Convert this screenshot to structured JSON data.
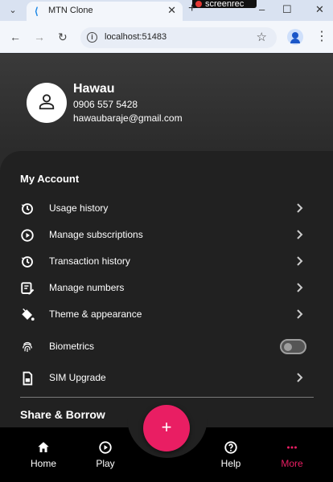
{
  "browser": {
    "tab_title": "MTN Clone",
    "url": "localhost:51483",
    "recorder_label": "screenrec"
  },
  "profile": {
    "name": "Hawau",
    "phone": "0906 557 5428",
    "email": "hawaubaraje@gmail.com"
  },
  "my_account": {
    "title": "My Account",
    "items": [
      {
        "label": "Usage history",
        "icon": "clock-history-icon"
      },
      {
        "label": "Manage subscriptions",
        "icon": "play-circle-icon"
      },
      {
        "label": "Transaction history",
        "icon": "clock-history-icon"
      },
      {
        "label": "Manage numbers",
        "icon": "edit-note-icon"
      },
      {
        "label": "Theme & appearance",
        "icon": "paint-bucket-icon"
      },
      {
        "label": "Biometrics",
        "icon": "fingerprint-icon",
        "toggle": false
      },
      {
        "label": "SIM Upgrade",
        "icon": "sim-card-icon"
      }
    ]
  },
  "share_borrow": {
    "title": "Share & Borrow"
  },
  "fab": {
    "label": "+"
  },
  "bottom_nav": [
    {
      "label": "Home",
      "icon": "home-icon"
    },
    {
      "label": "Play",
      "icon": "play-circle-icon"
    },
    {
      "label": "Help",
      "icon": "help-icon"
    },
    {
      "label": "More",
      "icon": "more-dots-icon",
      "active": true
    }
  ],
  "colors": {
    "accent": "#e91e63",
    "background": "#2b2b2b",
    "sheet": "#212121",
    "nav_background": "#000000"
  }
}
